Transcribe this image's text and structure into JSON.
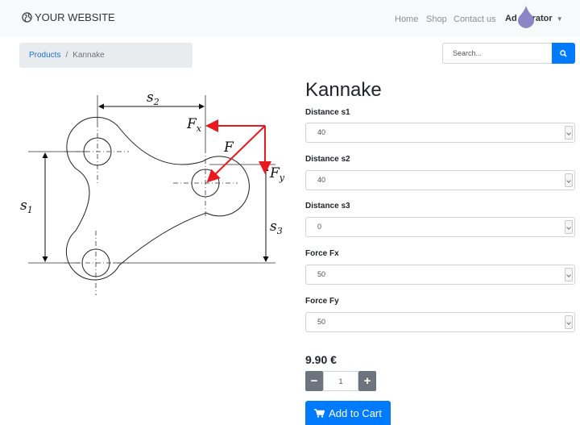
{
  "brand": {
    "text": "YOUR WEBSITE",
    "icon": "globe-icon"
  },
  "nav": {
    "links": [
      "Home",
      "Shop",
      "Contact us"
    ],
    "user": "Administrator",
    "user_visible": "Ad   strator"
  },
  "breadcrumb": {
    "link": "Products",
    "separator": "/",
    "current": "Kannake"
  },
  "search": {
    "placeholder": "Search...",
    "icon": "search-icon"
  },
  "diagram": {
    "labels": {
      "s1": "s1",
      "s2": "s2",
      "s3": "s3",
      "Fx": "Fx",
      "Fy": "Fy",
      "F": "F"
    },
    "force_color": "#e8191f"
  },
  "product": {
    "title": "Kannake",
    "fields": [
      {
        "label": "Distance s1",
        "value": "40"
      },
      {
        "label": "Distance s2",
        "value": "40"
      },
      {
        "label": "Distance s3",
        "value": "0"
      },
      {
        "label": "Force Fx",
        "value": "50"
      },
      {
        "label": "Force Fy",
        "value": "50"
      }
    ],
    "price": "9.90 €",
    "quantity": "1",
    "minus_label": "−",
    "plus_label": "+",
    "add_to_cart": "Add to Cart"
  },
  "colors": {
    "primary": "#007bff",
    "secondary": "#6c757d",
    "navbar": "#f8f9fa"
  }
}
